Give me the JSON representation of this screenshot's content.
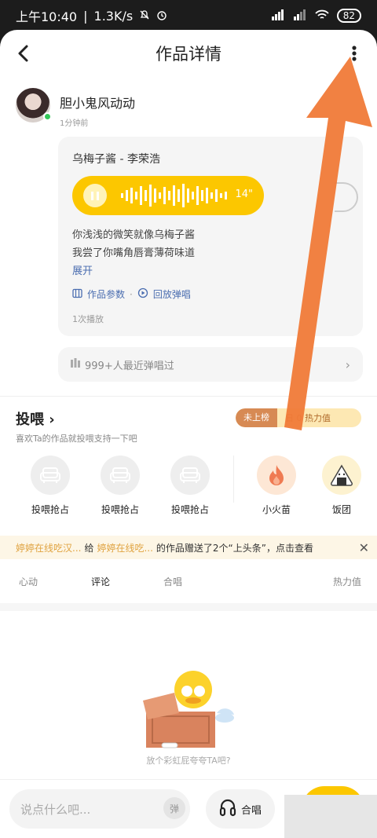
{
  "status_bar": {
    "time": "上午10:40",
    "speed": "1.3K/s",
    "battery": "82"
  },
  "header": {
    "title": "作品详情"
  },
  "author": {
    "name": "胆小鬼风动动",
    "time_ago": "1分钟前"
  },
  "work": {
    "song": "乌梅子酱 - 李荣浩",
    "duration": "14\"",
    "lyrics": [
      "你浅浅的微笑就像乌梅子酱",
      "我尝了你嘴角唇膏薄荷味道"
    ],
    "expand_label": "展开",
    "params_label": "作品参数",
    "replay_label": "回放弹唱",
    "play_count": "1次播放"
  },
  "recent_sung": "999+人最近弹唱过",
  "feed": {
    "title": "投喂",
    "subtitle": "喜欢Ta的作品就投喂支持一下吧",
    "rank_tag": "未上榜",
    "hot_value": "日 0 热力值",
    "gifts": [
      {
        "label": "投喂抢占",
        "icon": "sofa-icon"
      },
      {
        "label": "投喂抢占",
        "icon": "sofa-icon"
      },
      {
        "label": "投喂抢占",
        "icon": "sofa-icon"
      },
      {
        "label": "小火苗",
        "icon": "flame-icon"
      },
      {
        "label": "饭团",
        "icon": "onigiri-icon"
      }
    ]
  },
  "banner": {
    "user1": "婷婷在线吃汉...",
    "give": "给",
    "user2": "婷婷在线吃...",
    "text": "的作品赠送了2个“上头条”，点击查看"
  },
  "tabs": [
    "心动",
    "评论",
    "合唱",
    "热力值"
  ],
  "empty_state": "放个彩虹屁夸夸TA吧?",
  "bottom": {
    "comment_placeholder": "说点什么吧...",
    "danmu": "弹",
    "chorus": "合唱"
  },
  "colors": {
    "accent": "#fcc700",
    "annotation_arrow": "#f07a38",
    "link": "#4a6db0"
  }
}
